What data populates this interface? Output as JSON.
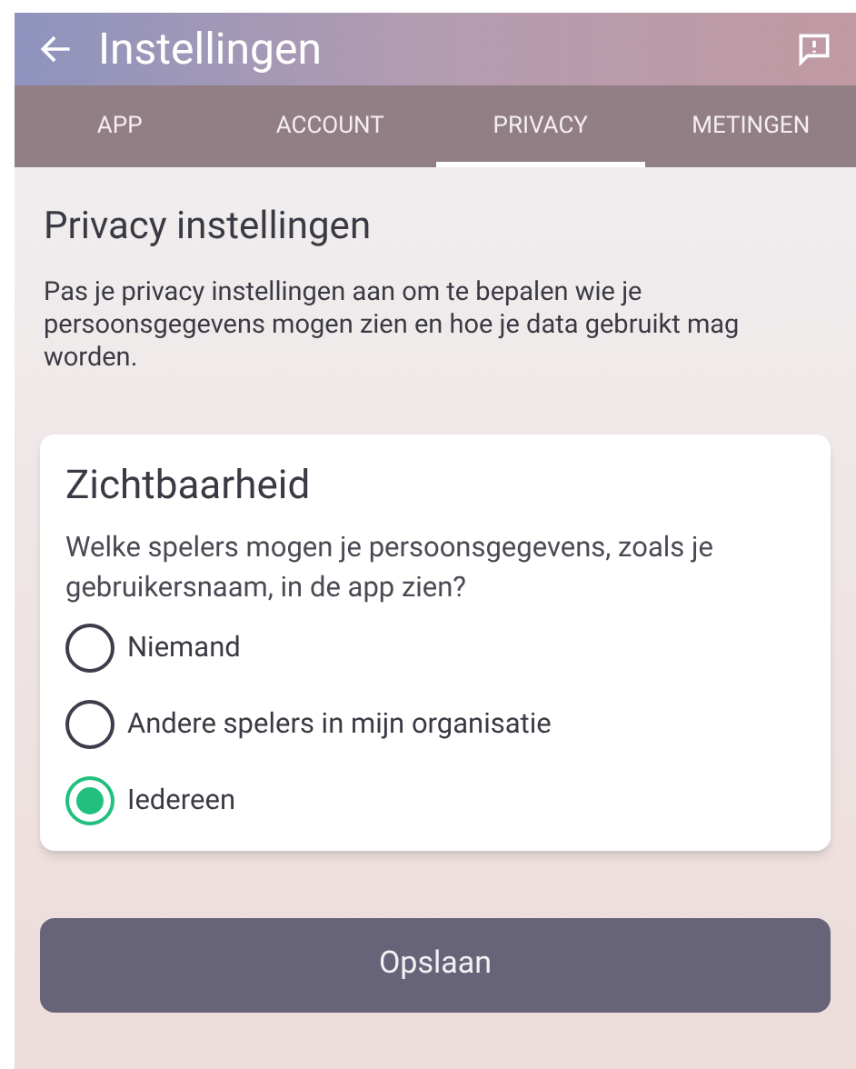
{
  "app_bar": {
    "title": "Instellingen"
  },
  "tabs": [
    {
      "label": "APP",
      "selected": false
    },
    {
      "label": "ACCOUNT",
      "selected": false
    },
    {
      "label": "PRIVACY",
      "selected": true
    },
    {
      "label": "METINGEN",
      "selected": false
    }
  ],
  "heading": "Privacy instellingen",
  "intro": "Pas je privacy instellingen aan om te bepalen wie je persoonsgegevens mogen zien en hoe je data gebruikt mag worden.",
  "card": {
    "title": "Zichtbaarheid",
    "question": "Welke spelers mogen je persoonsgegevens, zoals je gebruikersnaam, in de app zien?",
    "options": [
      {
        "label": "Niemand",
        "selected": false
      },
      {
        "label": "Andere spelers in mijn organisatie",
        "selected": false
      },
      {
        "label": "Iedereen",
        "selected": true
      }
    ]
  },
  "save_button": "Opslaan"
}
